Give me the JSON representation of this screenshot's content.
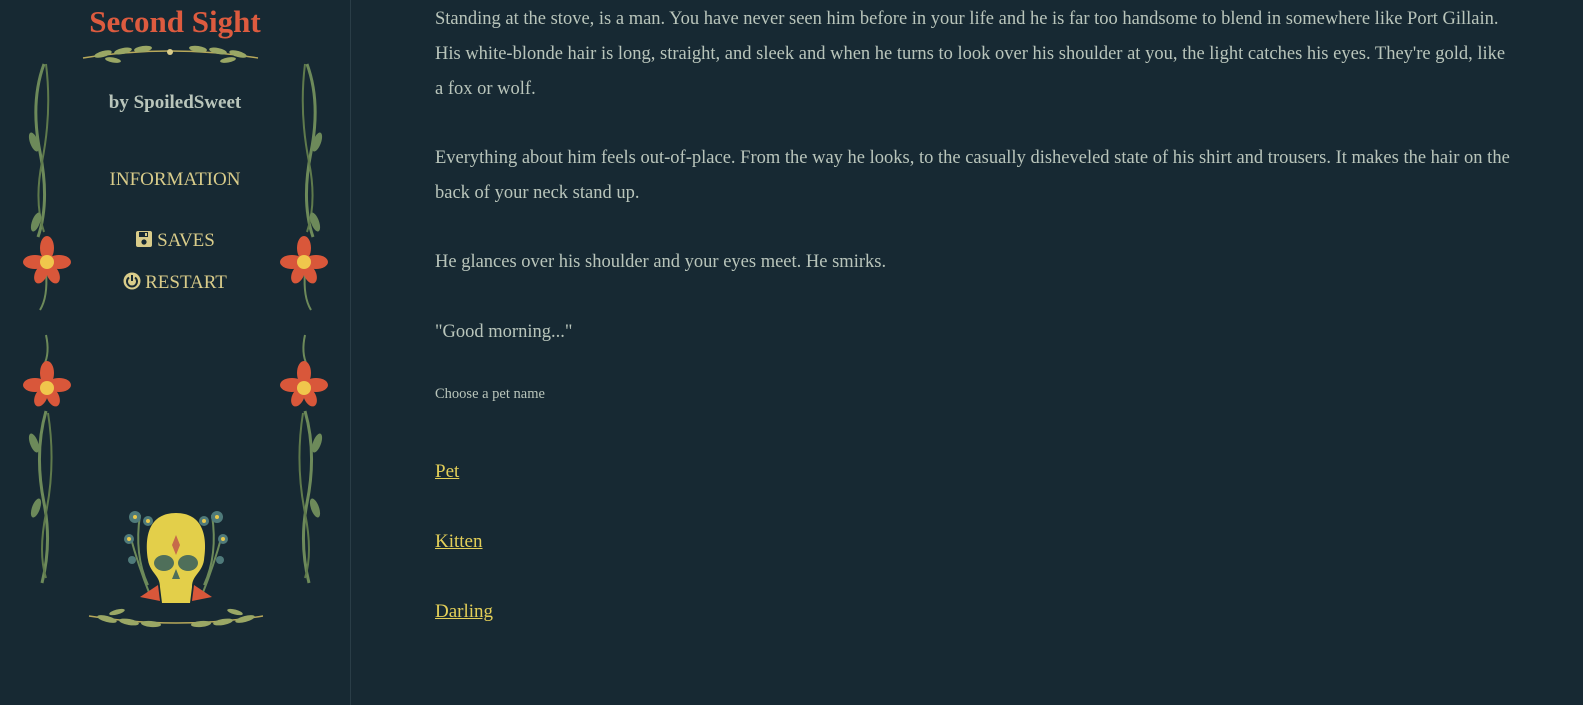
{
  "sidebar": {
    "title": "Second Sight",
    "author": "by SpoiledSweet",
    "menu": {
      "information": "INFORMATION",
      "saves": "SAVES",
      "restart": "RESTART"
    },
    "icons": {
      "saves": "floppy-disk-icon",
      "restart": "power-icon"
    }
  },
  "story": {
    "paragraphs": [
      "Standing at the stove, is a man. You have never seen him before in your life and he is far too handsome to blend in somewhere like Port Gillain. His white-blonde hair is long, straight, and sleek and when he turns to look over his shoulder at you, the light catches his eyes. They're gold, like a fox or wolf.",
      "Everything about him feels out-of-place. From the way he looks, to the casually disheveled state of his shirt and trousers. It makes the hair on the back of your neck stand up.",
      "He glances over his shoulder and your eyes meet. He smirks.",
      "\"Good morning...\""
    ],
    "prompt": "Choose a pet name",
    "choices": [
      "Pet",
      "Kitten",
      "Darling"
    ]
  },
  "colors": {
    "background": "#172933",
    "title": "#dd5b3f",
    "text": "#b9c5bb",
    "link": "#e3cf58",
    "flower": "#d9573a",
    "flower_center": "#f0c64c",
    "vine": "#6d8a5a"
  }
}
